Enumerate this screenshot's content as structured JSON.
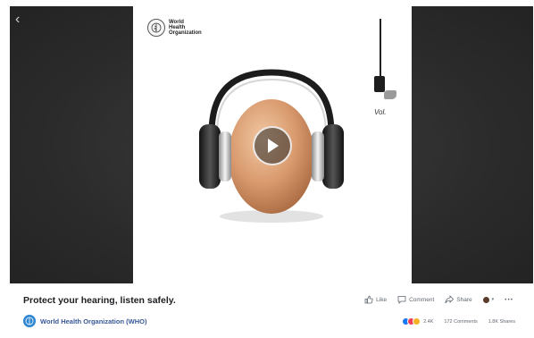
{
  "video": {
    "org_logo_text": "World Health\nOrganization",
    "volume_label": "Vol."
  },
  "post": {
    "title": "Protect your hearing, listen safely.",
    "author": "World Health Organization (WHO)",
    "actions": {
      "like": "Like",
      "comment": "Comment",
      "share": "Share"
    },
    "stats": {
      "reactions_count": "2.4K",
      "comments": "172 Comments",
      "shares": "1.8K Shares"
    }
  },
  "colors": {
    "viewer_bg": "#2b2b2b",
    "link_blue": "#385898",
    "like_blue": "#1877f2",
    "love_red": "#f33e58",
    "haha_yellow": "#f7b125"
  },
  "icons": {
    "back": "chevron-left-icon",
    "play": "play-icon",
    "like": "thumbs-up-icon",
    "comment": "comment-bubble-icon",
    "share": "share-arrow-icon",
    "more": "more-dots-icon"
  }
}
